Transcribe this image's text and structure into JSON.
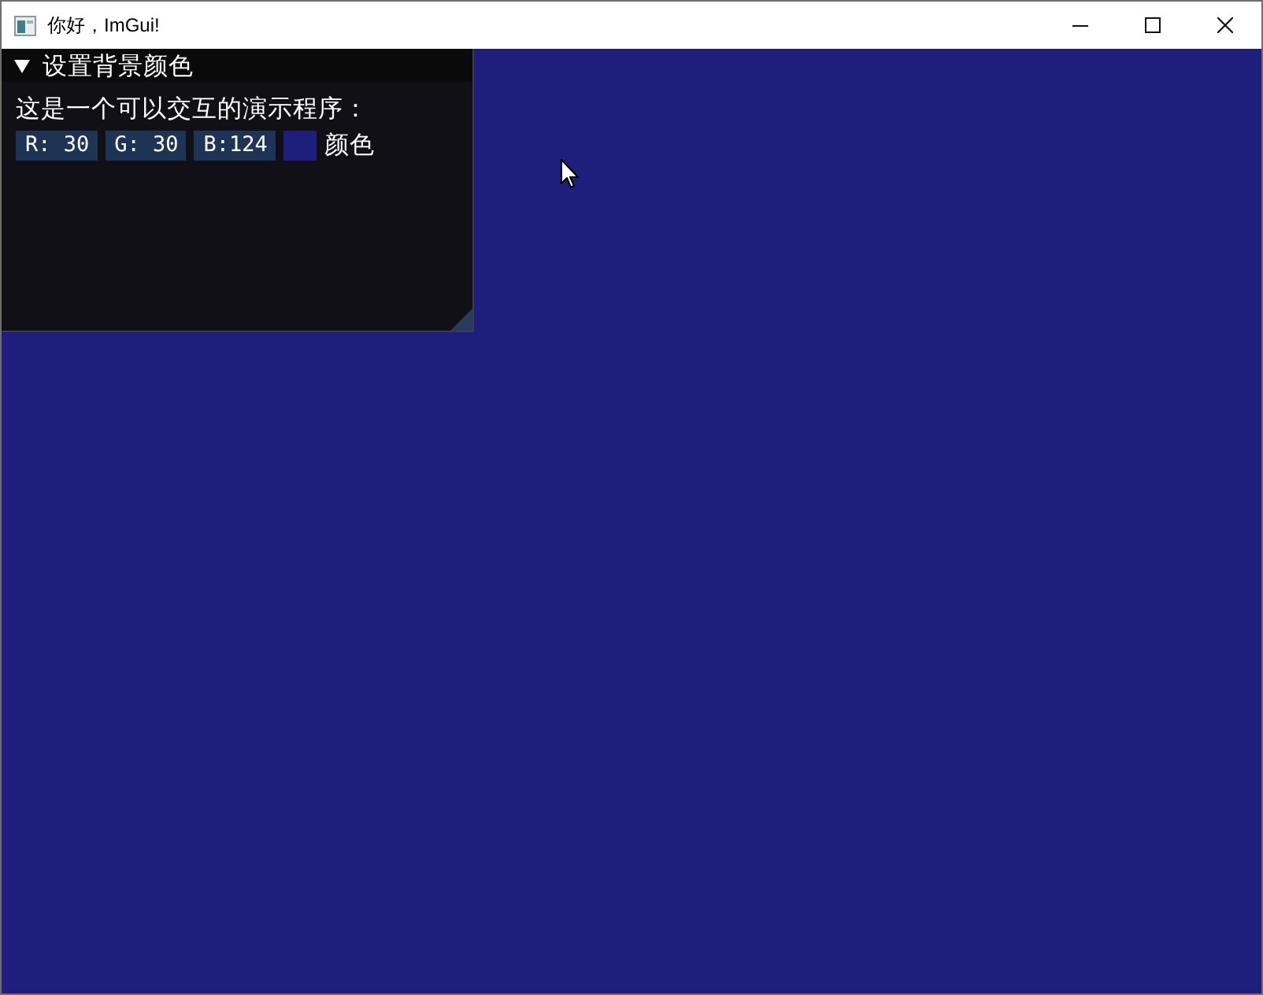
{
  "window": {
    "title": "你好，ImGui!"
  },
  "panel": {
    "title": "设置背景颜色",
    "expanded": true,
    "text": "这是一个可以交互的演示程序：",
    "color_edit": {
      "channels": [
        "R: 30",
        "G: 30",
        "B:124"
      ],
      "color": "#1e1e7c",
      "label": "颜色"
    }
  }
}
